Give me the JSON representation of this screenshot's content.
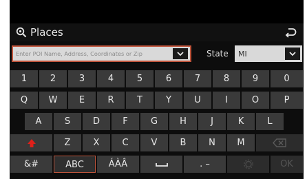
{
  "header": {
    "title": "Places",
    "search_icon": "search-icon",
    "back_icon": "back-arrow-icon"
  },
  "search": {
    "placeholder": "Enter POI Name, Address, Coordinates or Zip"
  },
  "state": {
    "label": "State",
    "value": "MI"
  },
  "keyboard": {
    "row1": [
      "1",
      "2",
      "3",
      "4",
      "5",
      "6",
      "7",
      "8",
      "9",
      "0"
    ],
    "row2": [
      "Q",
      "W",
      "E",
      "R",
      "T",
      "Y",
      "U",
      "I",
      "O",
      "P"
    ],
    "row3": [
      "A",
      "S",
      "D",
      "F",
      "G",
      "H",
      "J",
      "K",
      "L"
    ],
    "row4": [
      "Z",
      "X",
      "C",
      "V",
      "B",
      "N",
      "M"
    ],
    "row5": {
      "symbols": "&#",
      "abc": "ABC",
      "accents": "ÁÀÂ",
      "dot_dash": ". –",
      "ok": "OK"
    }
  },
  "colors": {
    "accent": "#c0553c",
    "shift": "#e0201a",
    "background": "#0d0d0d",
    "key": "#3a3a3a"
  }
}
